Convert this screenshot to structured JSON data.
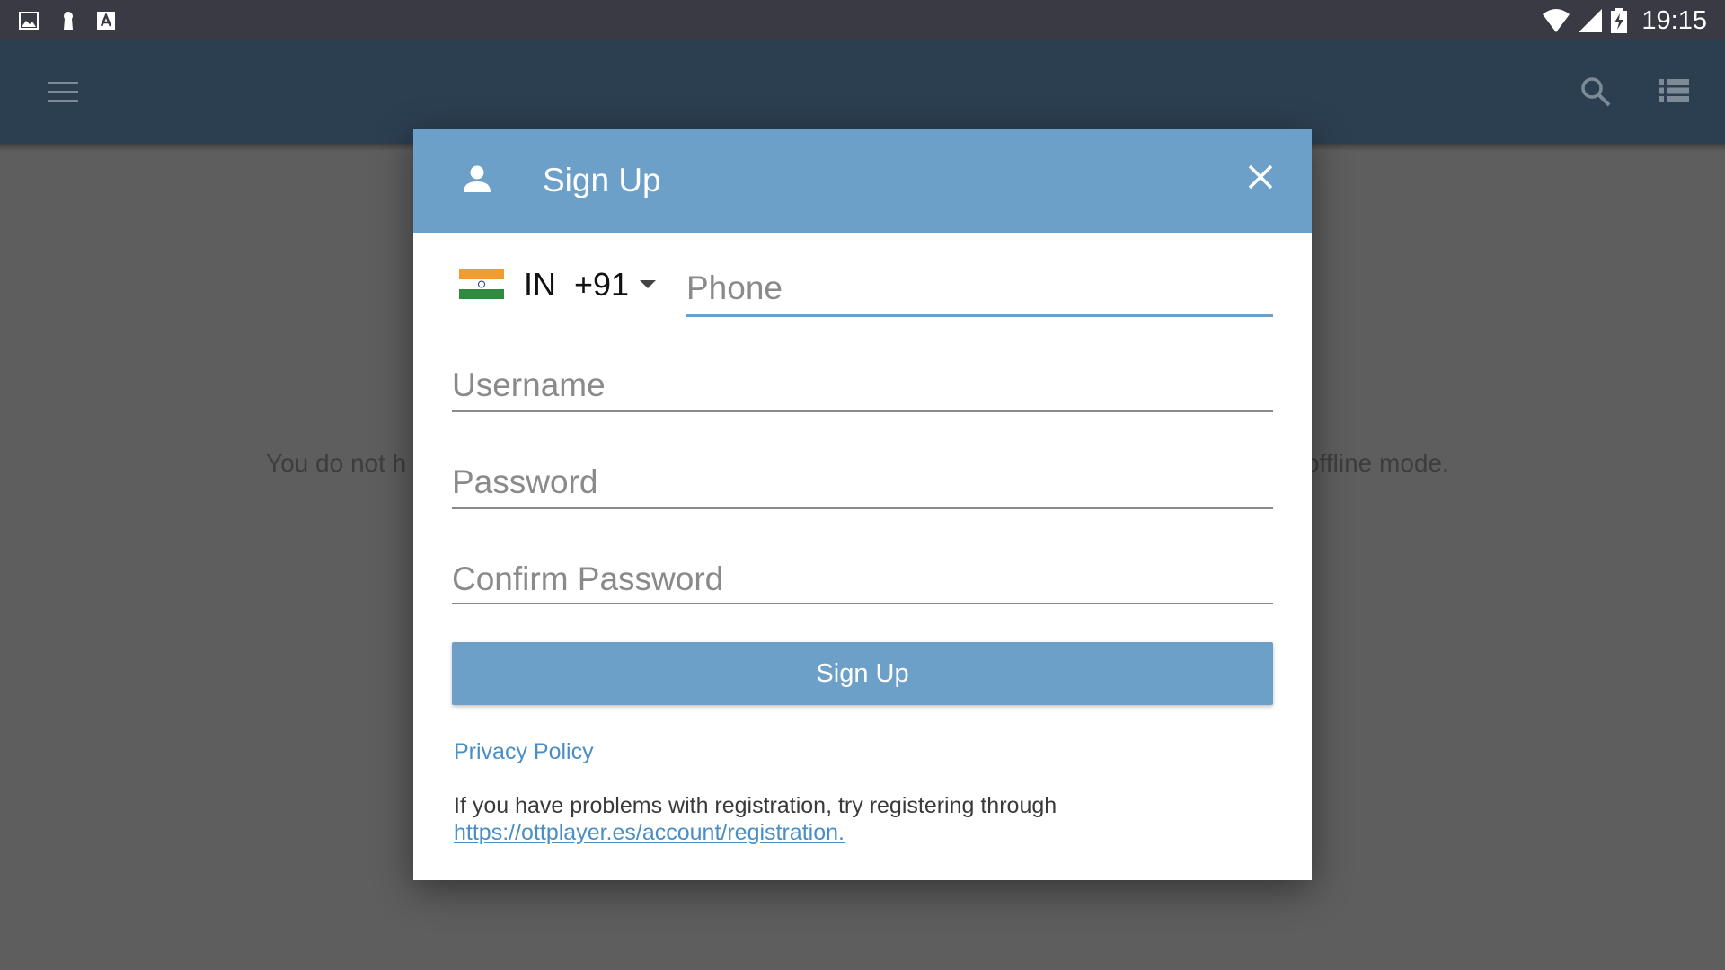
{
  "status_bar": {
    "time": "19:15",
    "left_icons": [
      "image-icon",
      "keyhole-icon",
      "font-a-icon"
    ],
    "right_icons": [
      "wifi-icon",
      "signal-icon",
      "battery-charging-icon"
    ]
  },
  "app_bar": {
    "color": "#2c3f51",
    "icons": [
      "menu-icon",
      "search-icon",
      "list-view-icon"
    ]
  },
  "background": {
    "message_left": "You do not h",
    "message_right": "offline mode."
  },
  "dialog": {
    "title": "Sign Up",
    "header_color": "#6ca0c9",
    "country": {
      "flag": "india-flag-icon",
      "code_label": "IN  +91"
    },
    "phone": {
      "placeholder": "Phone",
      "value": ""
    },
    "username": {
      "placeholder": "Username",
      "value": ""
    },
    "password": {
      "placeholder": "Password",
      "value": ""
    },
    "confirm_password": {
      "placeholder": "Confirm Password",
      "value": ""
    },
    "signup_button_label": "Sign Up",
    "privacy_link": "Privacy Policy",
    "help_text": "If you have problems with registration, try registering through ",
    "help_link": "https://ottplayer.es/account/registration."
  }
}
